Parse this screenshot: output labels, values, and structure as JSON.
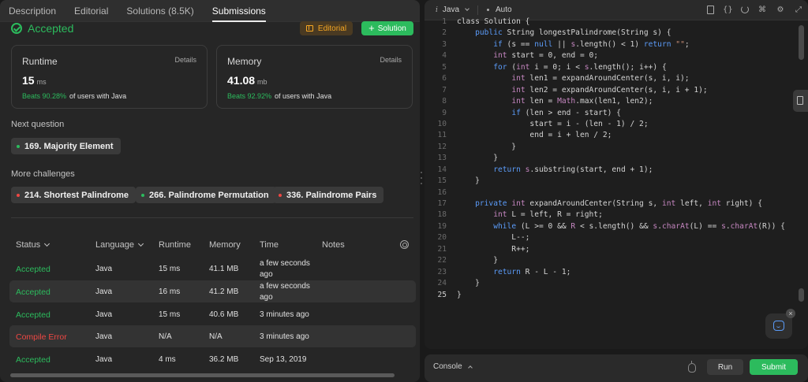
{
  "tabs": [
    {
      "label": "Description"
    },
    {
      "label": "Editorial"
    },
    {
      "label": "Solutions (8.5K)"
    },
    {
      "label": "Submissions"
    }
  ],
  "result": {
    "status": "Accepted",
    "editorial_button": "Editorial",
    "solution_button": "Solution"
  },
  "runtime": {
    "label": "Runtime",
    "details": "Details",
    "value": "15",
    "unit": "ms",
    "beats_pct": "Beats 90.28%",
    "beats_text": "of users with Java"
  },
  "memory": {
    "label": "Memory",
    "details": "Details",
    "value": "41.08",
    "unit": "mb",
    "beats_pct": "Beats 92.92%",
    "beats_text": "of users with Java"
  },
  "next_question": {
    "title": "Next question",
    "item": "169. Majority Element"
  },
  "more_challenges": {
    "title": "More challenges",
    "items": [
      "214. Shortest Palindrome",
      "266. Palindrome Permutation",
      "336. Palindrome Pairs"
    ]
  },
  "table": {
    "headers": [
      "Status",
      "Language",
      "Runtime",
      "Memory",
      "Time",
      "Notes"
    ],
    "rows": [
      {
        "status": "Accepted",
        "language": "Java",
        "runtime": "15 ms",
        "memory": "41.1 MB",
        "time1": "a few seconds",
        "time2": "ago"
      },
      {
        "status": "Accepted",
        "language": "Java",
        "runtime": "16 ms",
        "memory": "41.2 MB",
        "time1": "a few seconds",
        "time2": "ago"
      },
      {
        "status": "Accepted",
        "language": "Java",
        "runtime": "15 ms",
        "memory": "40.6 MB",
        "time1": "3 minutes ago",
        "time2": ""
      },
      {
        "status": "Compile Error",
        "language": "Java",
        "runtime": "N/A",
        "memory": "N/A",
        "time1": "3 minutes ago",
        "time2": ""
      },
      {
        "status": "Accepted",
        "language": "Java",
        "runtime": "4 ms",
        "memory": "36.2 MB",
        "time1": "Sep 13, 2019",
        "time2": ""
      }
    ]
  },
  "editor": {
    "language": "Java",
    "mode": "Auto",
    "line_numbers": [
      "1",
      "2",
      "3",
      "4",
      "5",
      "6",
      "7",
      "8",
      "9",
      "10",
      "11",
      "12",
      "13",
      "14",
      "15",
      "16",
      "17",
      "18",
      "19",
      "20",
      "21",
      "22",
      "23",
      "24",
      "25"
    ],
    "icons": [
      "bookmark-icon",
      "braces-icon",
      "reset-icon",
      "command-icon",
      "settings-icon",
      "expand-icon"
    ]
  },
  "bottom": {
    "console": "Console",
    "run": "Run",
    "submit": "Submit"
  },
  "colors": {
    "accent_green": "#2cbb5d",
    "error_red": "#ef4743",
    "editorial_orange": "#f5a623"
  }
}
